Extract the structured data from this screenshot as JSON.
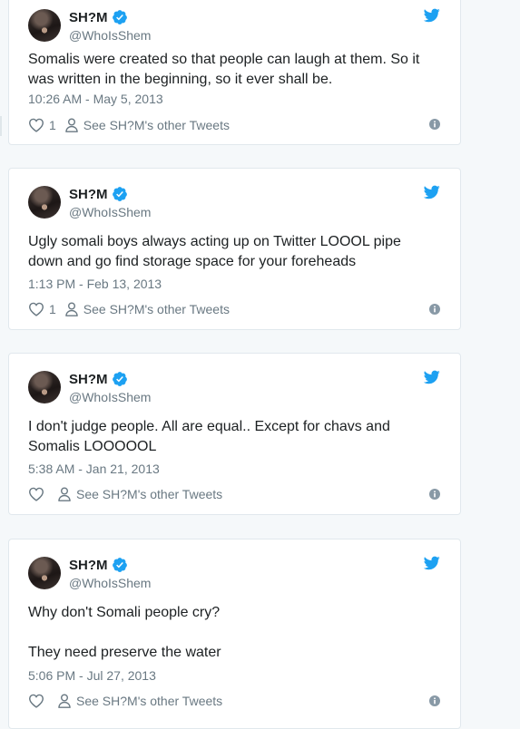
{
  "tweets": [
    {
      "name": "SH?M",
      "handle": "@WhoIsShem",
      "text": "Somalis were created so that people can laugh at them. So it was written in the beginning, so it ever shall be.",
      "date": "10:26 AM - May 5, 2013",
      "likes": "1",
      "other_label": "See SH?M's other Tweets"
    },
    {
      "name": "SH?M",
      "handle": "@WhoIsShem",
      "text": "Ugly somali boys always acting up on Twitter LOOOL pipe down and go find storage space for your foreheads",
      "date": "1:13 PM - Feb 13, 2013",
      "likes": "1",
      "other_label": "See SH?M's other Tweets"
    },
    {
      "name": "SH?M",
      "handle": "@WhoIsShem",
      "text": "I don't judge people. All are equal.. Except for chavs and Somalis LOOOOOL",
      "date": "5:38 AM - Jan 21, 2013",
      "likes": "",
      "other_label": "See SH?M's other Tweets"
    },
    {
      "name": "SH?M",
      "handle": "@WhoIsShem",
      "text_line1": "Why don't Somali people cry?",
      "text_line2": "They need preserve the water",
      "date": "5:06 PM - Jul 27, 2013",
      "likes": "",
      "other_label": "See SH?M's other Tweets"
    }
  ],
  "colors": {
    "twitter_blue": "#1da1f2",
    "secondary_text": "#697882",
    "border": "#e1e8ed"
  },
  "icons": [
    "twitter-bird-icon",
    "verified-badge-icon",
    "heart-icon",
    "person-icon",
    "info-icon"
  ]
}
